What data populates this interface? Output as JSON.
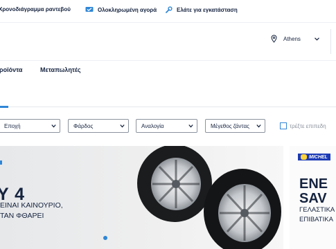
{
  "topbar": {
    "items": [
      {
        "label": "Χρονοδιάγραμμα ραντεβού",
        "icon": "calendar-icon"
      },
      {
        "label": "Ολοκληρωμένη αγορά",
        "icon": "cart-check-icon"
      },
      {
        "label": "Ελάτε για εγκατάσταση",
        "icon": "wrench-icon"
      }
    ]
  },
  "header": {
    "location": {
      "city": "Athens",
      "icon": "location-pin-icon"
    }
  },
  "nav": {
    "items": [
      "ροϊόντα",
      "Μεταπωλητές"
    ]
  },
  "filters": {
    "selects": [
      "Εποχή",
      "Φάρδος",
      "Αναλογία",
      "Μέγεθος ζάντας"
    ],
    "checkbox_label": "τρέξτε επιπεδη"
  },
  "banner": {
    "title": "Y 4",
    "line1": "ΕΙΝΑΙ ΚΑΙΝΟΥΡΙΟ,",
    "line2": "ΤΑΝ ΦΘΑΡΕΙ",
    "accent_color": "#2f86d6"
  },
  "promo": {
    "brand": "MICHEL",
    "title1": "ENE",
    "title2": "SAV",
    "line1": "ΓΕΛΑΣΤΙΚΑ",
    "line2": "ΕΠΙΒΑΤΙΚΑ"
  }
}
